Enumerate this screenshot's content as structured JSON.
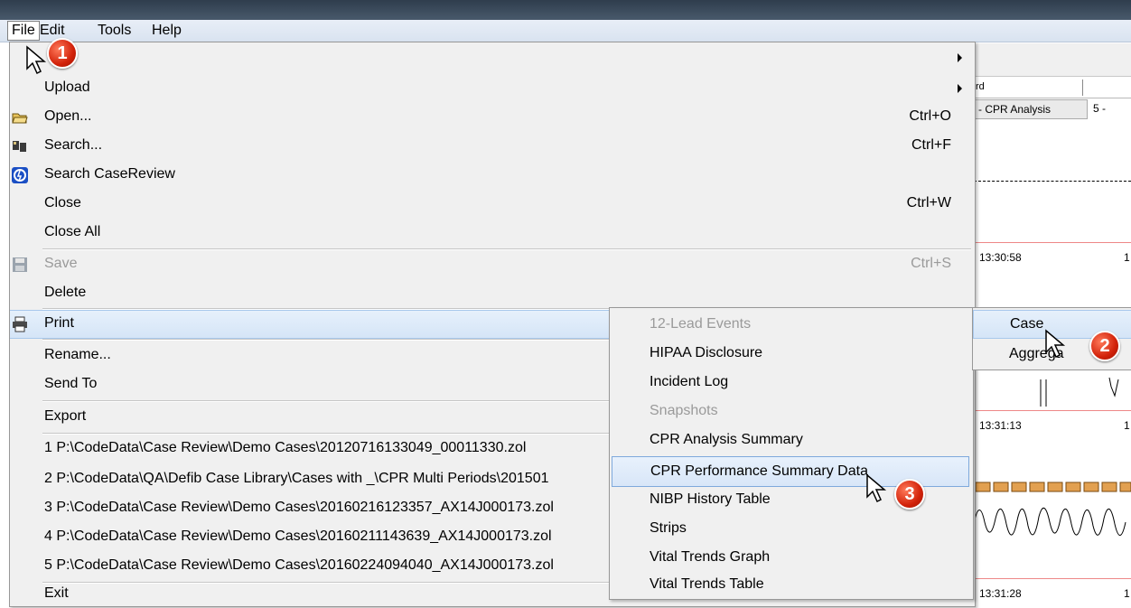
{
  "menubar": {
    "items": [
      "File",
      "Edit",
      "Tools",
      "Help"
    ],
    "edit_visible": "Edit"
  },
  "file_menu": {
    "upload": "Upload",
    "open": "Open...",
    "open_shortcut": "Ctrl+O",
    "search": "Search...",
    "search_shortcut": "Ctrl+F",
    "search_casereview": "Search CaseReview",
    "close": "Close",
    "close_shortcut": "Ctrl+W",
    "close_all": "Close All",
    "save": "Save",
    "save_shortcut": "Ctrl+S",
    "delete": "Delete",
    "print": "Print",
    "rename": "Rename...",
    "send_to": "Send To",
    "export": "Export",
    "recent": [
      "1 P:\\CodeData\\Case Review\\Demo Cases\\20120716133049_00011330.zol",
      "2 P:\\CodeData\\QA\\Defib Case Library\\Cases with _\\CPR Multi Periods\\201501",
      "3 P:\\CodeData\\Case Review\\Demo Cases\\20160216123357_AX14J000173.zol",
      "4 P:\\CodeData\\Case Review\\Demo Cases\\20160211143639_AX14J000173.zol",
      "5 P:\\CodeData\\Case Review\\Demo Cases\\20160224094040_AX14J000173.zol"
    ],
    "exit": "Exit"
  },
  "print_submenu": {
    "items": [
      "12-Lead Events",
      "HIPAA Disclosure",
      "Incident Log",
      "Snapshots",
      "CPR Analysis Summary",
      "CPR Performance Summary Data",
      "NIBP History Table",
      "Strips",
      "Vital Trends Graph",
      "Vital Trends Table"
    ]
  },
  "case_submenu": {
    "case": "Case",
    "aggregate": "Aggrega"
  },
  "background": {
    "tab_label": "rd",
    "tab_cpr": "- CPR Analysis",
    "tab_5": "5 -",
    "time1": "13:30:58",
    "time2": "13:31:13",
    "time3": "13:31:28",
    "edge1": "1",
    "edge2": "1",
    "edge3": "1"
  },
  "badges": [
    "1",
    "2",
    "3"
  ],
  "colors": {
    "badge": "#d2220a",
    "highlight": "#d5e5f7"
  }
}
